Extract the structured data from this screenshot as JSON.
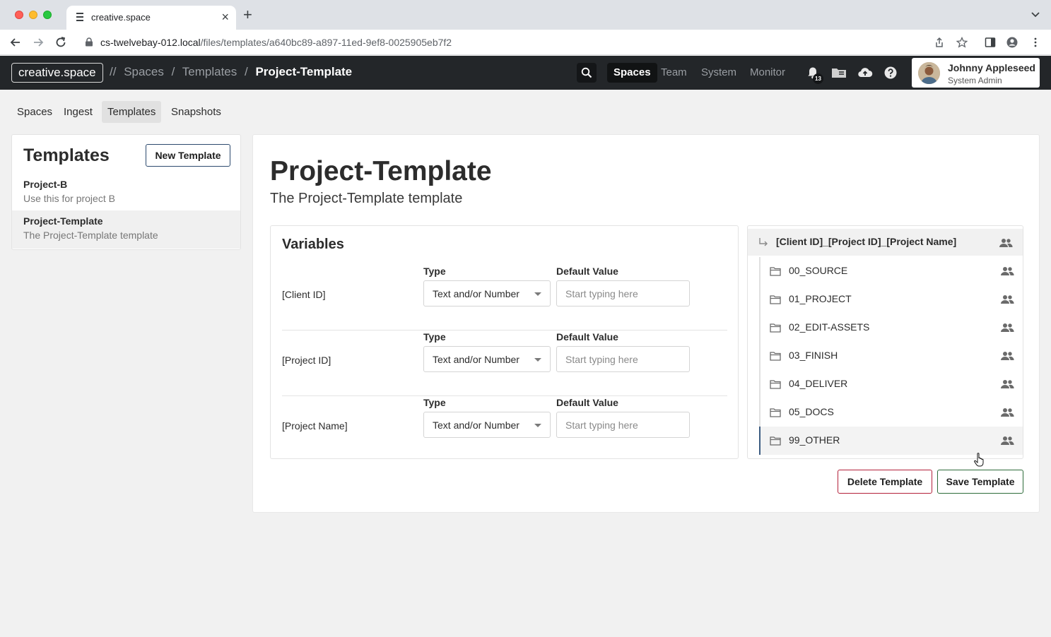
{
  "browser": {
    "tab_title": "creative.space",
    "url_host": "cs-twelvebay-012.local",
    "url_path": "/files/templates/a640bc89-a897-11ed-9ef8-0025905eb7f2"
  },
  "header": {
    "logo": "creative.space",
    "breadcrumb": {
      "prefix": "//",
      "items": [
        "Spaces",
        "Templates",
        "Project-Template"
      ],
      "separator": "/"
    },
    "nav": [
      "Spaces",
      "Team",
      "System",
      "Monitor"
    ],
    "active_nav": "Spaces",
    "notification_count": "13",
    "user": {
      "name": "Johnny Appleseed",
      "role": "System Admin"
    }
  },
  "subnav": {
    "items": [
      "Spaces",
      "Ingest",
      "Templates",
      "Snapshots"
    ],
    "active": "Templates"
  },
  "sidebar": {
    "title": "Templates",
    "new_button": "New Template",
    "templates": [
      {
        "name": "Project-B",
        "description": "Use this for project B"
      },
      {
        "name": "Project-Template",
        "description": "The Project-Template template"
      }
    ]
  },
  "main": {
    "title": "Project-Template",
    "subtitle": "The Project-Template template",
    "variables": {
      "title": "Variables",
      "type_label": "Type",
      "default_label": "Default Value",
      "rows": [
        {
          "name": "[Client ID]",
          "type": "Text and/or Number",
          "default_placeholder": "Start typing here",
          "default_value": ""
        },
        {
          "name": "[Project ID]",
          "type": "Text and/or Number",
          "default_placeholder": "Start typing here",
          "default_value": ""
        },
        {
          "name": "[Project Name]",
          "type": "Text and/or Number",
          "default_placeholder": "Start typing here",
          "default_value": ""
        }
      ]
    },
    "tree": {
      "root": "[Client ID]_[Project ID]_[Project Name]",
      "folders": [
        "00_SOURCE",
        "01_PROJECT",
        "02_EDIT-ASSETS",
        "03_FINISH",
        "04_DELIVER",
        "05_DOCS",
        "99_OTHER"
      ],
      "selected": "99_OTHER"
    },
    "delete_button": "Delete Template",
    "save_button": "Save Template"
  },
  "colors": {
    "header_bg": "#232629",
    "delete_border": "#b3203a",
    "save_border": "#2d6b3a",
    "page_bg": "#f1f1f1"
  }
}
